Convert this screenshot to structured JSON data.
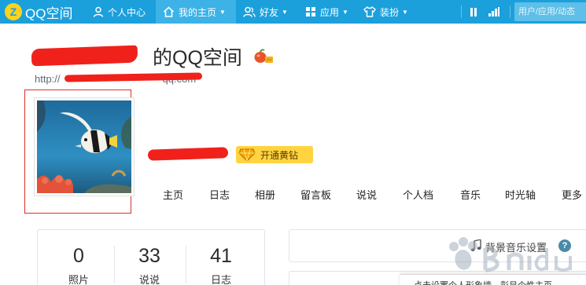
{
  "topbar": {
    "logo_text": "QQ空间",
    "nav": [
      {
        "label": "个人中心",
        "icon": "person-icon"
      },
      {
        "label": "我的主页",
        "icon": "home-icon"
      },
      {
        "label": "好友",
        "icon": "friends-icon"
      },
      {
        "label": "应用",
        "icon": "apps-icon"
      },
      {
        "label": "装扮",
        "icon": "tshirt-icon"
      }
    ],
    "caret": "▼",
    "search_placeholder": "用户/应用/动态"
  },
  "space": {
    "title": "的QQ空间",
    "url": "http://",
    "url_tail": "qq.com"
  },
  "vip": {
    "label": "开通黄钻"
  },
  "tabs": [
    "主页",
    "日志",
    "相册",
    "留言板",
    "说说",
    "个人档",
    "音乐",
    "时光轴",
    "更多"
  ],
  "stats": [
    {
      "value": "0",
      "label": "照片"
    },
    {
      "value": "33",
      "label": "说说"
    },
    {
      "value": "41",
      "label": "日志"
    }
  ],
  "music": {
    "label": "背景音乐设置",
    "help": "?"
  },
  "popup": {
    "text": "点击设置个人形象墙，彰显个性主页"
  },
  "colors": {
    "topbar": "#1ba0dc",
    "active_tab": "#3cb2e6",
    "vip_badge": "#ffd440",
    "redaction": "#f0211b",
    "highlight": "#d9302b"
  }
}
